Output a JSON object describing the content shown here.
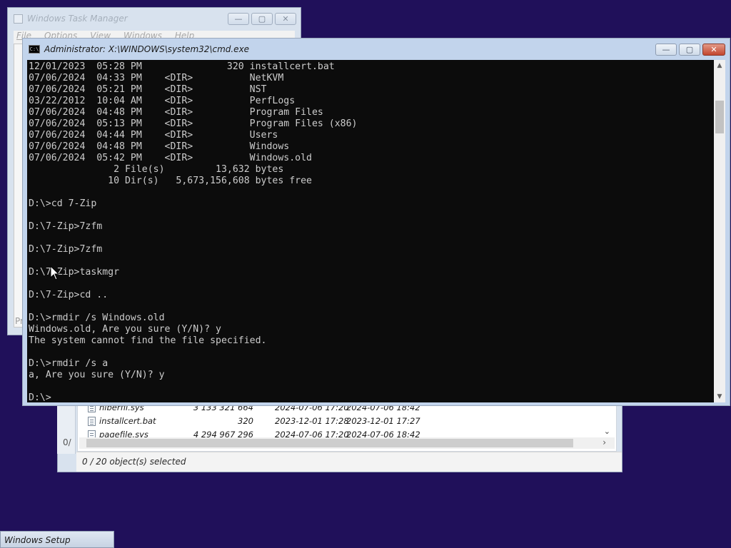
{
  "taskmgr": {
    "title": "Windows Task Manager",
    "menu": [
      "File",
      "Options",
      "View",
      "Windows",
      "Help"
    ],
    "status_fragment": "Pr"
  },
  "explorer": {
    "back_pane_fragment": "0/",
    "rows": [
      {
        "name": "hiberfil.sys",
        "size": "3 133 321 664",
        "modified": "2024-07-06 17:20",
        "created": "2024-07-06 18:42"
      },
      {
        "name": "installcert.bat",
        "size": "320",
        "modified": "2023-12-01 17:28",
        "created": "2023-12-01 17:27"
      },
      {
        "name": "pagefile.sys",
        "size": "4 294 967 296",
        "modified": "2024-07-06 17:20",
        "created": "2024-07-06 18:42"
      }
    ],
    "status": "0 / 20 object(s) selected"
  },
  "cmd": {
    "title": "Administrator: X:\\WINDOWS\\system32\\cmd.exe",
    "icon_text": "C:\\",
    "lines": [
      "12/01/2023  05:28 PM               320 installcert.bat",
      "07/06/2024  04:33 PM    <DIR>          NetKVM",
      "07/06/2024  05:21 PM    <DIR>          NST",
      "03/22/2012  10:04 AM    <DIR>          PerfLogs",
      "07/06/2024  04:48 PM    <DIR>          Program Files",
      "07/06/2024  05:13 PM    <DIR>          Program Files (x86)",
      "07/06/2024  04:44 PM    <DIR>          Users",
      "07/06/2024  04:48 PM    <DIR>          Windows",
      "07/06/2024  05:42 PM    <DIR>          Windows.old",
      "               2 File(s)         13,632 bytes",
      "              10 Dir(s)   5,673,156,608 bytes free",
      "",
      "D:\\>cd 7-Zip",
      "",
      "D:\\7-Zip>7zfm",
      "",
      "D:\\7-Zip>7zfm",
      "",
      "D:\\7-Zip>taskmgr",
      "",
      "D:\\7-Zip>cd ..",
      "",
      "D:\\>rmdir /s Windows.old",
      "Windows.old, Are you sure (Y/N)? y",
      "The system cannot find the file specified.",
      "",
      "D:\\>rmdir /s a",
      "a, Are you sure (Y/N)? y",
      "",
      "D:\\>"
    ]
  },
  "taskbar": {
    "label": "Windows Setup"
  },
  "window_buttons": {
    "minimize": "—",
    "maximize": "▢",
    "close": "✕"
  }
}
